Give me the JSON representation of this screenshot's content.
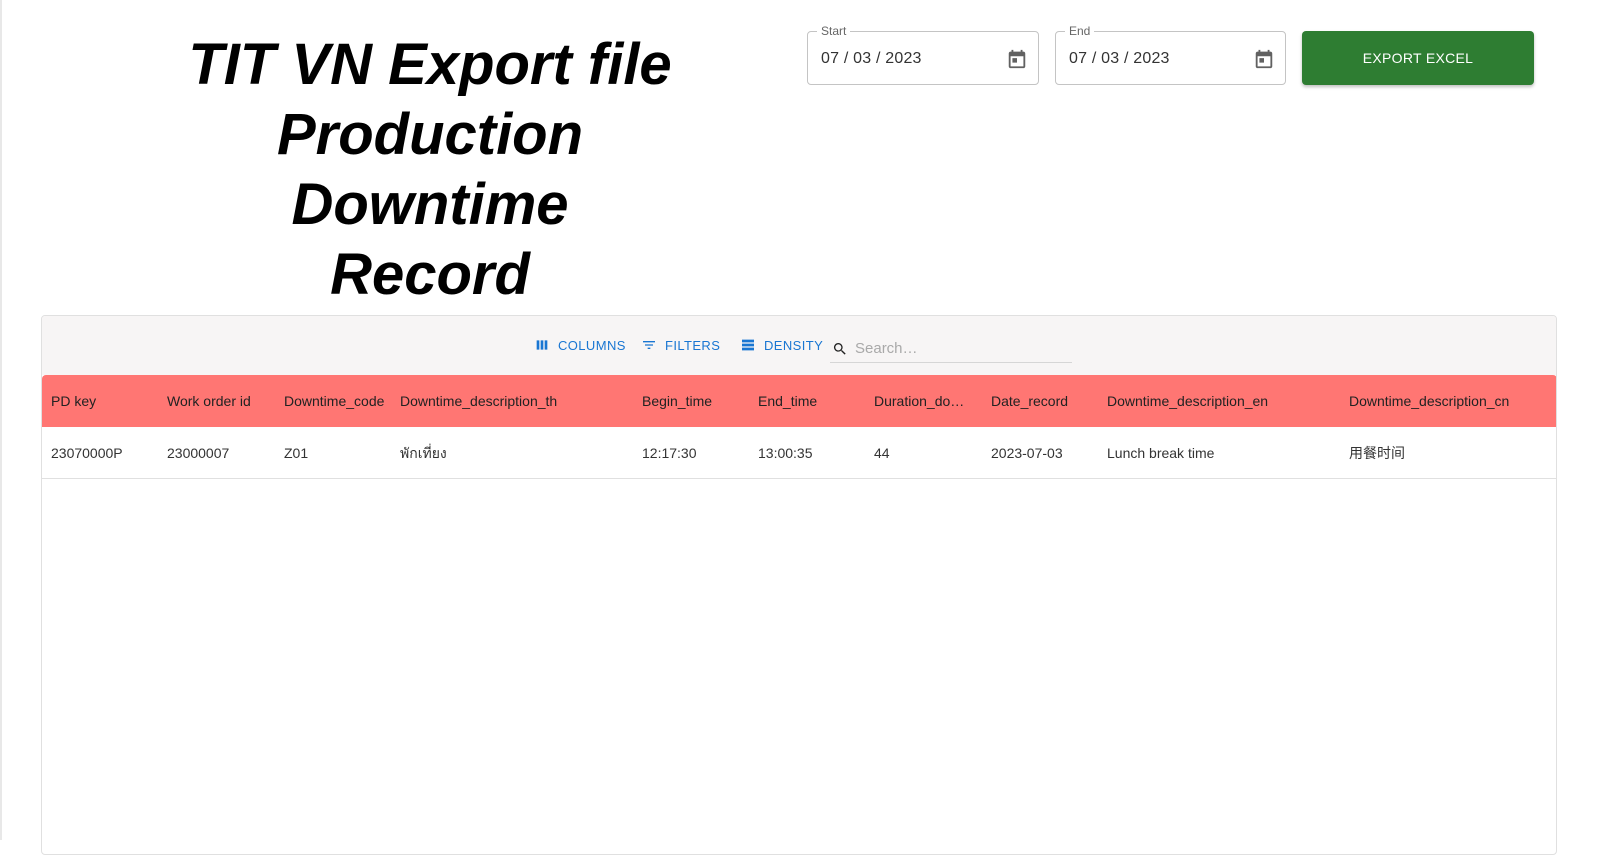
{
  "page": {
    "title_lines": [
      "TIT VN Export file",
      "Production Downtime",
      "Record"
    ]
  },
  "date_range": {
    "start": {
      "label": "Start",
      "value": "07 / 03 / 2023"
    },
    "end": {
      "label": "End",
      "value": "07 / 03 / 2023"
    }
  },
  "export_button": {
    "label": "EXPORT EXCEL",
    "color": "#2e7d32"
  },
  "toolbar": {
    "columns_label": "COLUMNS",
    "filters_label": "FILTERS",
    "density_label": "DENSITY",
    "search_placeholder": "Search…",
    "accent_color": "#1976d2"
  },
  "table": {
    "header_color": "#ff7673",
    "columns": [
      "PD key",
      "Work order id",
      "Downtime_code",
      "Downtime_description_th",
      "Begin_time",
      "End_time",
      "Duration_downtime",
      "Date_record",
      "Downtime_description_en",
      "Downtime_description_cn"
    ],
    "rows": [
      [
        "23070000P",
        "23000007",
        "Z01",
        "พักเที่ยง",
        "12:17:30",
        "13:00:35",
        "44",
        "2023-07-03",
        "Lunch break time",
        "用餐时间"
      ]
    ]
  }
}
